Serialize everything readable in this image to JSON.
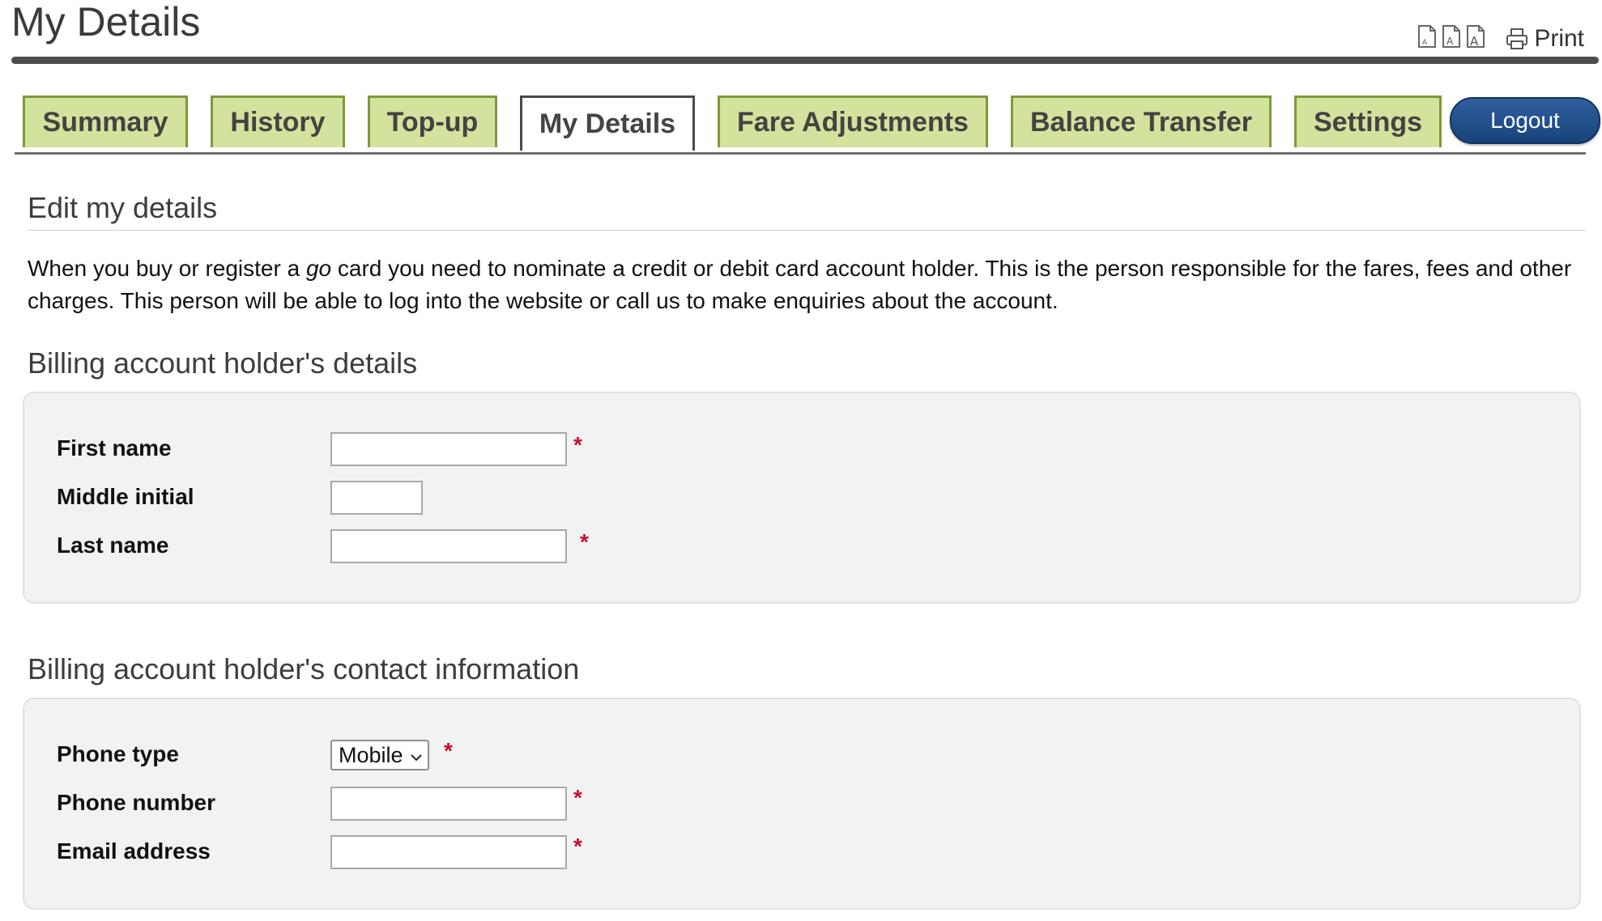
{
  "page": {
    "title": "My Details"
  },
  "tools": {
    "print_label": "Print"
  },
  "tabs": [
    {
      "label": "Summary"
    },
    {
      "label": "History"
    },
    {
      "label": "Top-up"
    },
    {
      "label": "My Details",
      "active": true
    },
    {
      "label": "Fare Adjustments"
    },
    {
      "label": "Balance Transfer"
    },
    {
      "label": "Settings"
    }
  ],
  "logout": {
    "label": "Logout"
  },
  "edit": {
    "heading": "Edit my details",
    "intro_before": "When you buy or register a ",
    "intro_em": "go",
    "intro_after": " card you need to nominate a credit or debit card account holder. This is the person responsible for the fares, fees and other charges. This person will be able to log into the website or call us to make enquiries about the account."
  },
  "billing_details": {
    "heading": "Billing account holder's details",
    "fields": {
      "first_name": {
        "label": "First name",
        "value": "",
        "required": true
      },
      "middle_initial": {
        "label": "Middle initial",
        "value": ""
      },
      "last_name": {
        "label": "Last name",
        "value": "",
        "required": true
      }
    }
  },
  "contact": {
    "heading": "Billing account holder's contact information",
    "fields": {
      "phone_type": {
        "label": "Phone type",
        "selected": "Mobile",
        "required": true
      },
      "phone_number": {
        "label": "Phone number",
        "value": "",
        "required": true
      },
      "email": {
        "label": "Email address",
        "value": "",
        "required": true
      }
    }
  },
  "required_marker": "*",
  "colors": {
    "tab_bg": "#d3e29c",
    "tab_border": "#7c9a3a",
    "logout_bg": "#1e4d8a",
    "required": "#c8102e",
    "panel_bg": "#f3f2f2"
  },
  "icons": {
    "text_size_small": "text-size-small-icon",
    "text_size_medium": "text-size-medium-icon",
    "text_size_large": "text-size-large-icon",
    "print": "printer-icon",
    "select_arrow": "chevron-down-icon"
  }
}
